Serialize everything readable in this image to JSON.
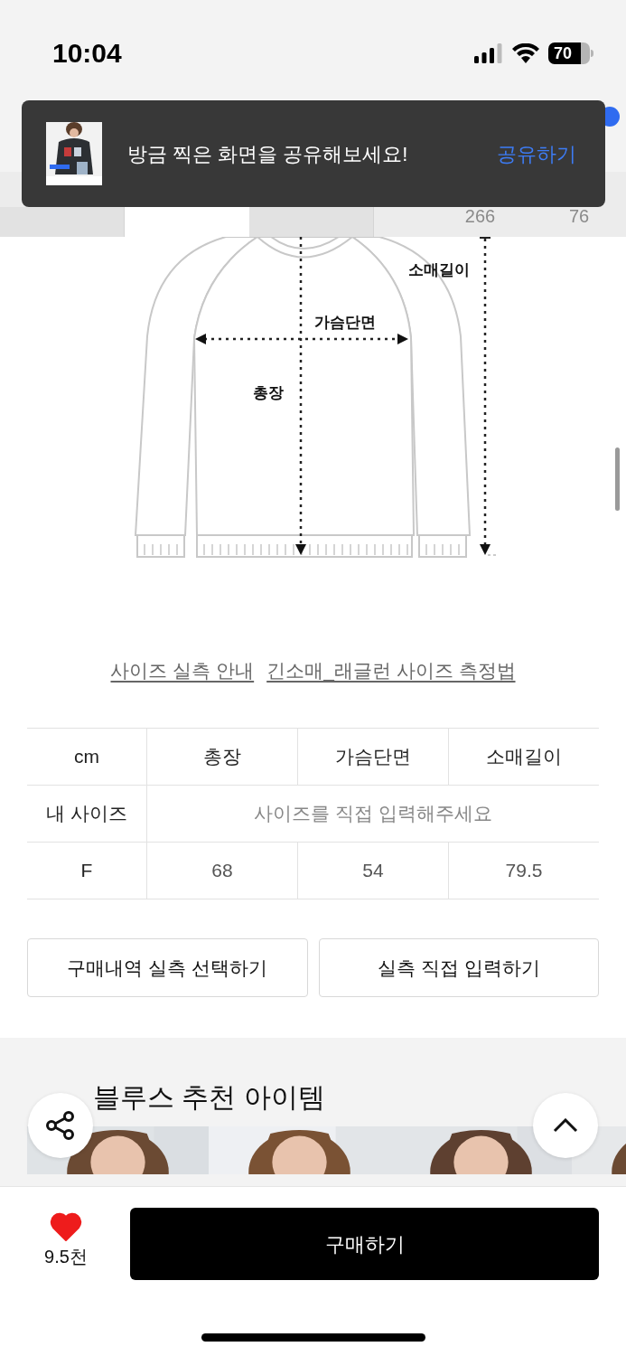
{
  "status_bar": {
    "time": "10:04",
    "battery": "70"
  },
  "toast": {
    "message": "방금 찍은 화면을 공유해보세요!",
    "action": "공유하기"
  },
  "tabs": [
    {
      "selected": false
    },
    {
      "selected": true
    },
    {
      "selected": false
    }
  ],
  "tab_counts": [
    "266",
    "76"
  ],
  "diagram": {
    "labels": {
      "sleeve": "소매길이",
      "chest": "가슴단면",
      "length": "총장"
    }
  },
  "guide_links": [
    "사이즈 실측 안내",
    "긴소매_래글런 사이즈 측정법"
  ],
  "size_table": {
    "columns": [
      "cm",
      "총장",
      "가슴단면",
      "소매길이"
    ],
    "my_size": {
      "label": "내 사이즈",
      "placeholder": "사이즈를 직접 입력해주세요"
    },
    "rows": [
      {
        "size": "F",
        "values": [
          "68",
          "54",
          "79.5"
        ]
      }
    ]
  },
  "size_buttons": [
    "구매내역 실측 선택하기",
    "실측 직접 입력하기"
  ],
  "recommend": {
    "title": "블루스 추천 아이템"
  },
  "bottom_bar": {
    "liked": true,
    "like_count": "9.5천",
    "buy": "구매하기"
  }
}
